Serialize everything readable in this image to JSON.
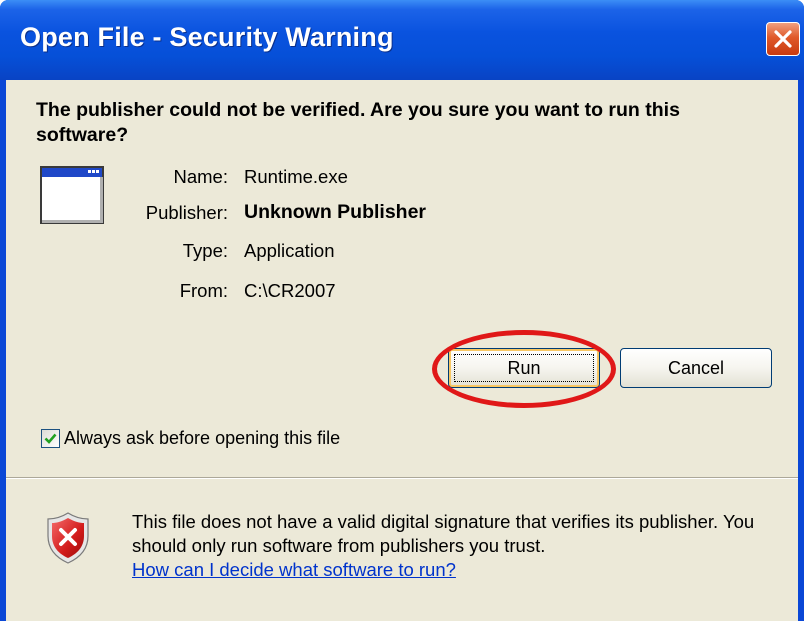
{
  "window": {
    "title": "Open File - Security Warning",
    "close_icon": "close-icon"
  },
  "question": "The publisher could not be verified.  Are you sure you want to run this software?",
  "details": {
    "icon": "application-window-icon",
    "name_label": "Name:",
    "name_value": "Runtime.exe",
    "publisher_label": "Publisher:",
    "publisher_value": "Unknown Publisher",
    "type_label": "Type:",
    "type_value": "Application",
    "from_label": "From:",
    "from_value": "C:\\CR2007"
  },
  "buttons": {
    "run_label": "Run",
    "cancel_label": "Cancel"
  },
  "annotation": {
    "highlight_color": "#e01818",
    "highlight_target": "run-button"
  },
  "checkbox": {
    "checked": true,
    "label": "Always ask before opening this file"
  },
  "warning": {
    "icon": "shield-error-icon",
    "text": "This file does not have a valid digital signature that verifies its publisher.  You should only run software from publishers you trust.",
    "link": "How can I decide what software to run?"
  },
  "colors": {
    "titlebar": "#0650d8",
    "dialog_background": "#ece9d8",
    "link": "#0033cc",
    "close_button": "#e05a2a"
  }
}
